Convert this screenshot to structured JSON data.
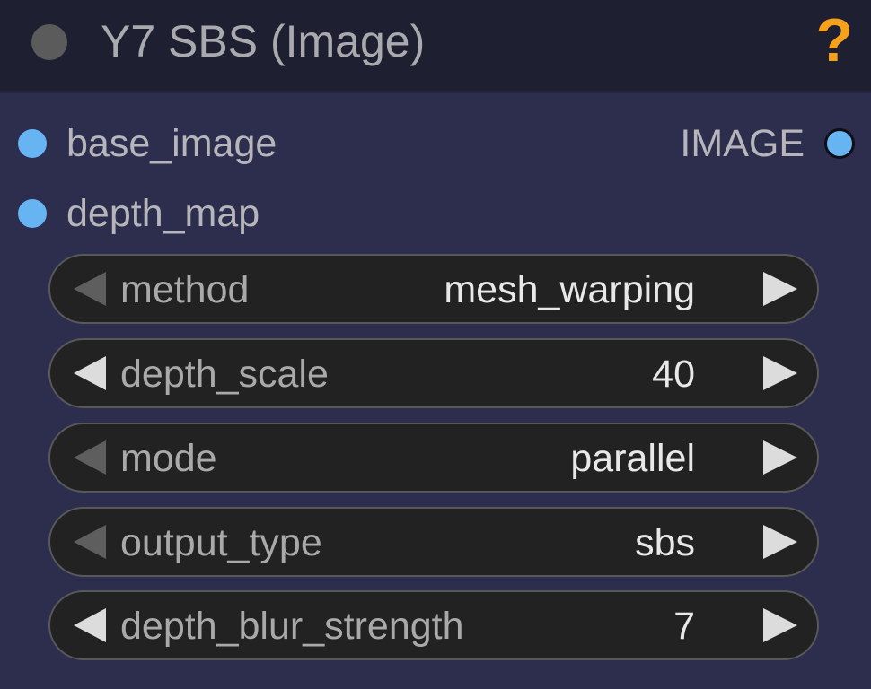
{
  "node": {
    "title": "Y7 SBS (Image)",
    "help_label": "?",
    "colors": {
      "header_bg": "#1f1f32",
      "body_bg": "#2d2d4e",
      "slot_dot": "#66b4f2",
      "help": "#f5a11c",
      "widget_bg": "#222222"
    }
  },
  "inputs": [
    {
      "label": "base_image"
    },
    {
      "label": "depth_map"
    }
  ],
  "outputs": [
    {
      "label": "IMAGE"
    }
  ],
  "widgets": [
    {
      "label": "method",
      "value": "mesh_warping",
      "left_arrow_enabled": false
    },
    {
      "label": "depth_scale",
      "value": "40",
      "left_arrow_enabled": true
    },
    {
      "label": "mode",
      "value": "parallel",
      "left_arrow_enabled": false
    },
    {
      "label": "output_type",
      "value": "sbs",
      "left_arrow_enabled": false
    },
    {
      "label": "depth_blur_strength",
      "value": "7",
      "left_arrow_enabled": true
    }
  ],
  "icons": {
    "header_status": "collapse-dot-icon",
    "help": "help-icon",
    "left_arrow": "decrement-arrow-icon",
    "right_arrow": "increment-arrow-icon"
  }
}
